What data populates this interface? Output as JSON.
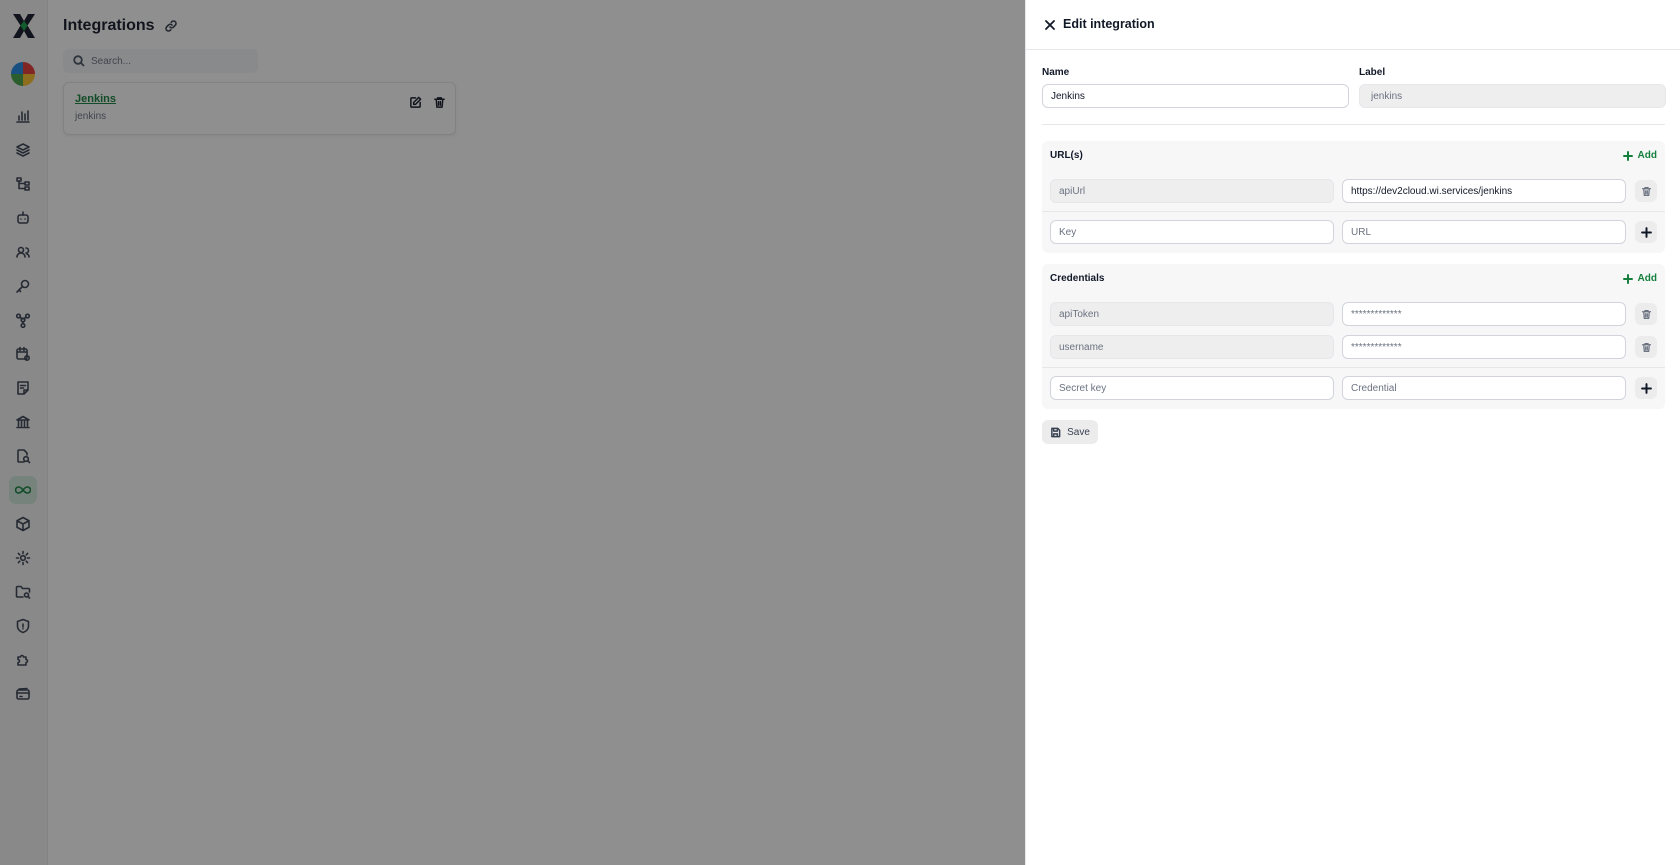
{
  "sidebar": {
    "items": [
      {
        "icon": "bar-chart-icon"
      },
      {
        "icon": "layers-icon"
      },
      {
        "icon": "tree-structure-icon"
      },
      {
        "icon": "robot-icon"
      },
      {
        "icon": "users-icon"
      },
      {
        "icon": "key-icon"
      },
      {
        "icon": "network-icon"
      },
      {
        "icon": "calendar-settings-icon"
      },
      {
        "icon": "notes-icon"
      },
      {
        "icon": "bank-icon"
      },
      {
        "icon": "search-document-icon"
      },
      {
        "icon": "infinity-icon",
        "active": true
      },
      {
        "icon": "box-icon"
      },
      {
        "icon": "settings-icon"
      },
      {
        "icon": "folder-search-icon"
      },
      {
        "icon": "shield-icon"
      },
      {
        "icon": "puzzle-icon"
      },
      {
        "icon": "credit-card-icon"
      }
    ],
    "accent_color": "#15803d"
  },
  "page": {
    "title": "Integrations",
    "search_placeholder": "Search..."
  },
  "integrations": [
    {
      "name": "Jenkins",
      "label": "jenkins"
    }
  ],
  "drawer": {
    "title": "Edit integration",
    "name_label": "Name",
    "name_value": "Jenkins",
    "label_label": "Label",
    "label_value": "jenkins",
    "urls": {
      "title": "URL(s)",
      "add_label": "Add",
      "rows": [
        {
          "key": "apiUrl",
          "value": "https://dev2cloud.wi.services/jenkins"
        }
      ],
      "new_key_placeholder": "Key",
      "new_value_placeholder": "URL"
    },
    "credentials": {
      "title": "Credentials",
      "add_label": "Add",
      "rows": [
        {
          "key": "apiToken",
          "value": "*************"
        },
        {
          "key": "username",
          "value": "*************"
        }
      ],
      "new_key_placeholder": "Secret key",
      "new_value_placeholder": "Credential"
    },
    "save_label": "Save"
  }
}
